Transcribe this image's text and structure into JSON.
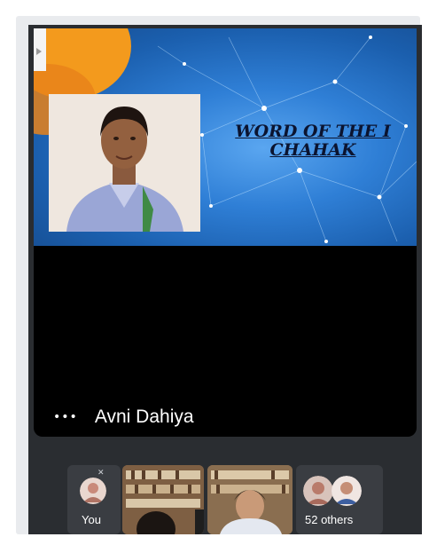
{
  "presenter": {
    "name": "Avni Dahiya",
    "more_options_glyph": "•••"
  },
  "slide": {
    "title_line1": "WORD OF THE I",
    "title_line2": "CHAHAK"
  },
  "participants": {
    "self_label": "You",
    "others_label": "52 others"
  },
  "colors": {
    "meeting_bg": "#2a2d31",
    "stage_bg": "#000000",
    "slide_blue": "#2f7fd6",
    "accent_orange": "#f39a1d"
  }
}
